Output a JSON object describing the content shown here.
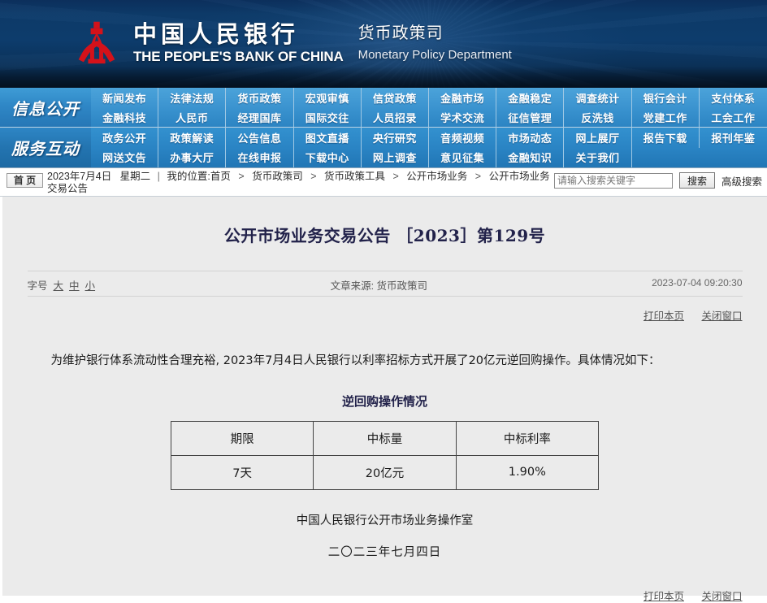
{
  "banner": {
    "logo_icon": "pbc-logo-icon",
    "bank_name_cn": "中国人民银行",
    "bank_name_en": "THE PEOPLE'S BANK OF CHINA",
    "department_cn": "货币政策司",
    "department_en": "Monetary Policy Department",
    "bg_color": "#0d3c6c"
  },
  "nav": {
    "accent_color": "#2f8bcb",
    "sections": [
      {
        "label": "信息公开"
      },
      {
        "label": "服务互动"
      }
    ],
    "rows": [
      [
        "新闻发布",
        "法律法规",
        "货币政策",
        "宏观审慎",
        "信贷政策",
        "金融市场",
        "金融稳定",
        "调查统计",
        "银行会计",
        "支付体系"
      ],
      [
        "金融科技",
        "人民币",
        "经理国库",
        "国际交往",
        "人员招录",
        "学术交流",
        "征信管理",
        "反洗钱",
        "党建工作",
        "工会工作"
      ],
      [
        "政务公开",
        "政策解读",
        "公告信息",
        "图文直播",
        "央行研究",
        "音频视频",
        "市场动态",
        "网上展厅",
        "报告下载",
        "报刊年鉴"
      ],
      [
        "网送文告",
        "办事大厅",
        "在线申报",
        "下载中心",
        "网上调查",
        "意见征集",
        "金融知识",
        "关于我们",
        "",
        ""
      ]
    ]
  },
  "crumbbar": {
    "home_label": "首 页",
    "date": "2023年7月4日",
    "weekday": "星期二",
    "divider": "|",
    "position_label": "我的位置:",
    "trail": [
      "首页",
      "货币政策司",
      "货币政策工具",
      "公开市场业务",
      "公开市场业务交易公告"
    ],
    "separator": ">",
    "search": {
      "placeholder": "请输入搜索关键字",
      "value": "",
      "button_label": "搜索",
      "advanced_label": "高级搜索"
    }
  },
  "article": {
    "title": "公开市场业务交易公告 ［2023］第129号",
    "font_size_label": "字号",
    "font_size_options": [
      "大",
      "中",
      "小"
    ],
    "source_label": "文章来源:",
    "source_value": "货币政策司",
    "publish_time": "2023-07-04  09:20:30",
    "tools": [
      "打印本页",
      "关闭窗口"
    ],
    "paragraph": "为维护银行体系流动性合理充裕, 2023年7月4日人民银行以利率招标方式开展了20亿元逆回购操作。具体情况如下：",
    "table_title": "逆回购操作情况",
    "table": {
      "headers": [
        "期限",
        "中标量",
        "中标利率"
      ],
      "rows": [
        [
          "7天",
          "20亿元",
          "1.90%"
        ]
      ]
    },
    "signature": "中国人民银行公开市场业务操作室",
    "date_cn": "二〇二三年七月四日",
    "bottom_tools": [
      "打印本页",
      "关闭窗口"
    ]
  }
}
